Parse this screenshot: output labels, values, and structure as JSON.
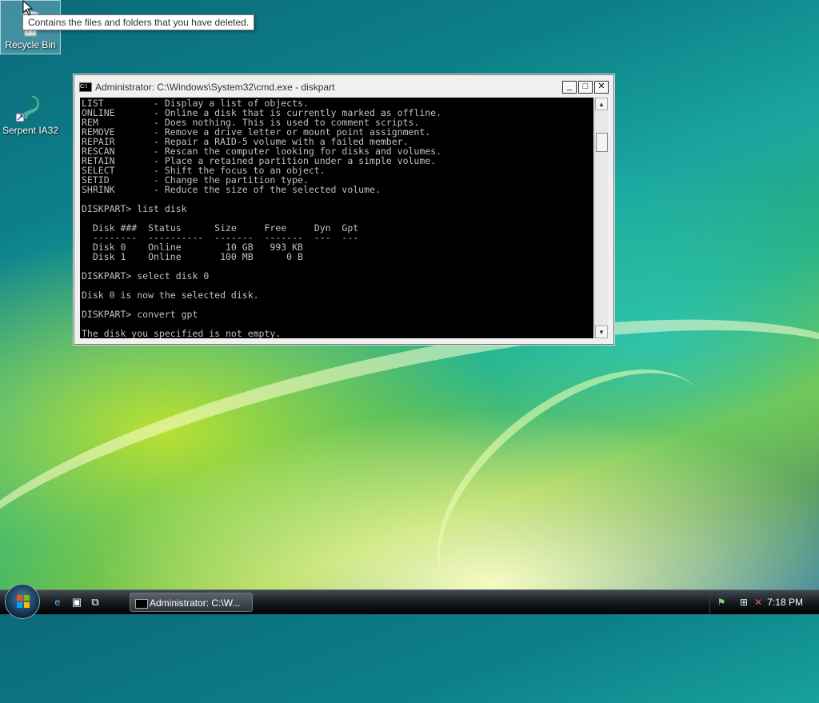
{
  "desktop": {
    "icons": [
      {
        "label": "Recycle Bin"
      },
      {
        "label": "Serpent IA32"
      }
    ],
    "tooltip": "Contains the files and folders that you have deleted."
  },
  "cmd_window": {
    "title": "Administrator: C:\\Windows\\System32\\cmd.exe - diskpart",
    "console_lines": [
      "LIST         - Display a list of objects.",
      "ONLINE       - Online a disk that is currently marked as offline.",
      "REM          - Does nothing. This is used to comment scripts.",
      "REMOVE       - Remove a drive letter or mount point assignment.",
      "REPAIR       - Repair a RAID-5 volume with a failed member.",
      "RESCAN       - Rescan the computer looking for disks and volumes.",
      "RETAIN       - Place a retained partition under a simple volume.",
      "SELECT       - Shift the focus to an object.",
      "SETID        - Change the partition type.",
      "SHRINK       - Reduce the size of the selected volume.",
      "",
      "DISKPART> list disk",
      "",
      "  Disk ###  Status      Size     Free     Dyn  Gpt",
      "  --------  ----------  -------  -------  ---  ---",
      "  Disk 0    Online        10 GB   993 KB",
      "  Disk 1    Online       100 MB      0 B",
      "",
      "DISKPART> select disk 0",
      "",
      "Disk 0 is now the selected disk.",
      "",
      "DISKPART> convert gpt",
      "",
      "The disk you specified is not empty."
    ]
  },
  "taskbar": {
    "task_button_label": "Administrator: C:\\W...",
    "clock": "7:18 PM"
  }
}
